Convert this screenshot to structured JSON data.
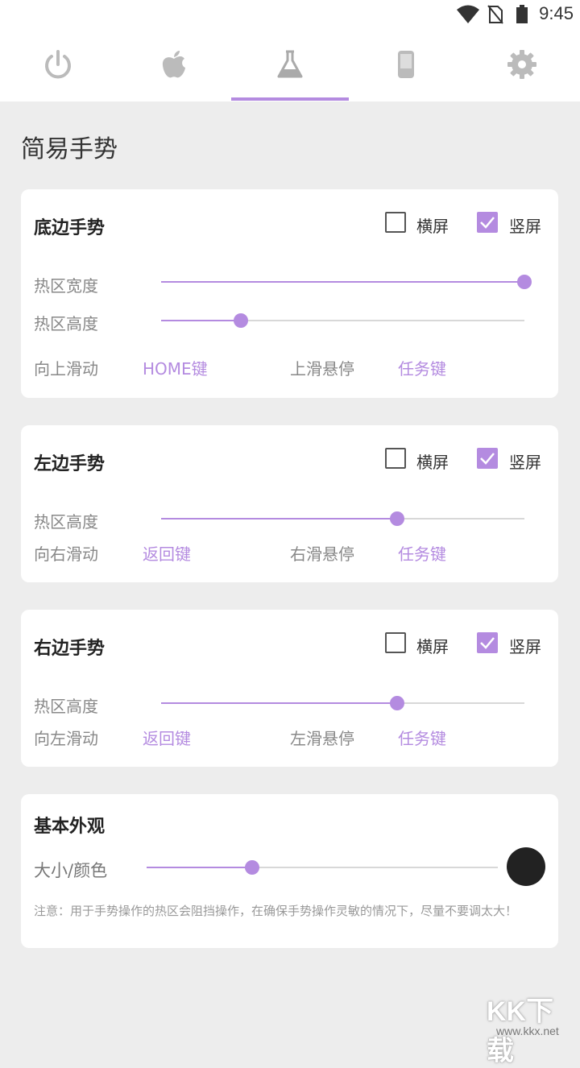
{
  "status_bar": {
    "time": "9:45",
    "icons": [
      "wifi-icon",
      "no-sim-icon",
      "battery-icon"
    ]
  },
  "tabs": [
    {
      "icon": "power-icon",
      "selected": false
    },
    {
      "icon": "apple-icon",
      "selected": false
    },
    {
      "icon": "flask-icon",
      "selected": true
    },
    {
      "icon": "phone-icon",
      "selected": false
    },
    {
      "icon": "gear-icon",
      "selected": false
    }
  ],
  "page_title": "简易手势",
  "bottom_card": {
    "title": "底边手势",
    "landscape_label": "横屏",
    "landscape_checked": false,
    "portrait_label": "竖屏",
    "portrait_checked": true,
    "hotzone_width_label": "热区宽度",
    "hotzone_width_value": 1.0,
    "hotzone_height_label": "热区高度",
    "hotzone_height_value": 0.22,
    "swipe_label": "向上滑动",
    "swipe_value": "HOME键",
    "hover_label": "上滑悬停",
    "hover_value": "任务键"
  },
  "left_card": {
    "title": "左边手势",
    "landscape_label": "横屏",
    "landscape_checked": false,
    "portrait_label": "竖屏",
    "portrait_checked": true,
    "hotzone_height_label": "热区高度",
    "hotzone_height_value": 0.65,
    "swipe_label": "向右滑动",
    "swipe_value": "返回键",
    "hover_label": "右滑悬停",
    "hover_value": "任务键"
  },
  "right_card": {
    "title": "右边手势",
    "landscape_label": "横屏",
    "landscape_checked": false,
    "portrait_label": "竖屏",
    "portrait_checked": true,
    "hotzone_height_label": "热区高度",
    "hotzone_height_value": 0.65,
    "swipe_label": "向左滑动",
    "swipe_value": "返回键",
    "hover_label": "左滑悬停",
    "hover_value": "任务键"
  },
  "appearance_card": {
    "title": "基本外观",
    "size_color_label": "大小/颜色",
    "size_value": 0.3,
    "color": "#222222",
    "note": "注意：用于手势操作的热区会阻挡操作，在确保手势操作灵敏的情况下，尽量不要调太大！"
  },
  "watermark": {
    "text": "KK下载",
    "url": "www.kkx.net"
  },
  "colors": {
    "accent": "#b48be0",
    "background": "#ededed",
    "card": "#ffffff"
  }
}
